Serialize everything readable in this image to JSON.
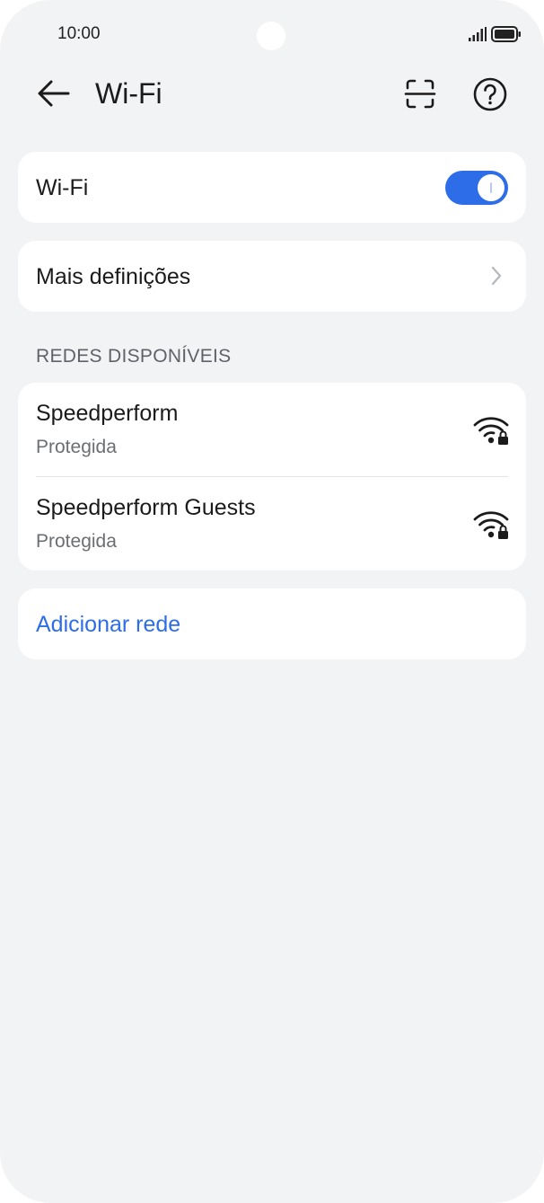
{
  "status_bar": {
    "time": "10:00"
  },
  "header": {
    "title": "Wi-Fi",
    "back_icon": "arrow-left-icon",
    "scan_icon": "scan-qr-icon",
    "help_icon": "help-circle-icon"
  },
  "wifi_toggle": {
    "label": "Wi-Fi",
    "enabled": true,
    "accent_color": "#2d6ee8"
  },
  "more_settings": {
    "label": "Mais definições"
  },
  "available_networks": {
    "header": "REDES DISPONÍVEIS",
    "items": [
      {
        "name": "Speedperform",
        "status": "Protegida",
        "icon": "wifi-lock-icon"
      },
      {
        "name": "Speedperform Guests",
        "status": "Protegida",
        "icon": "wifi-lock-icon"
      }
    ]
  },
  "add_network": {
    "label": "Adicionar rede"
  }
}
